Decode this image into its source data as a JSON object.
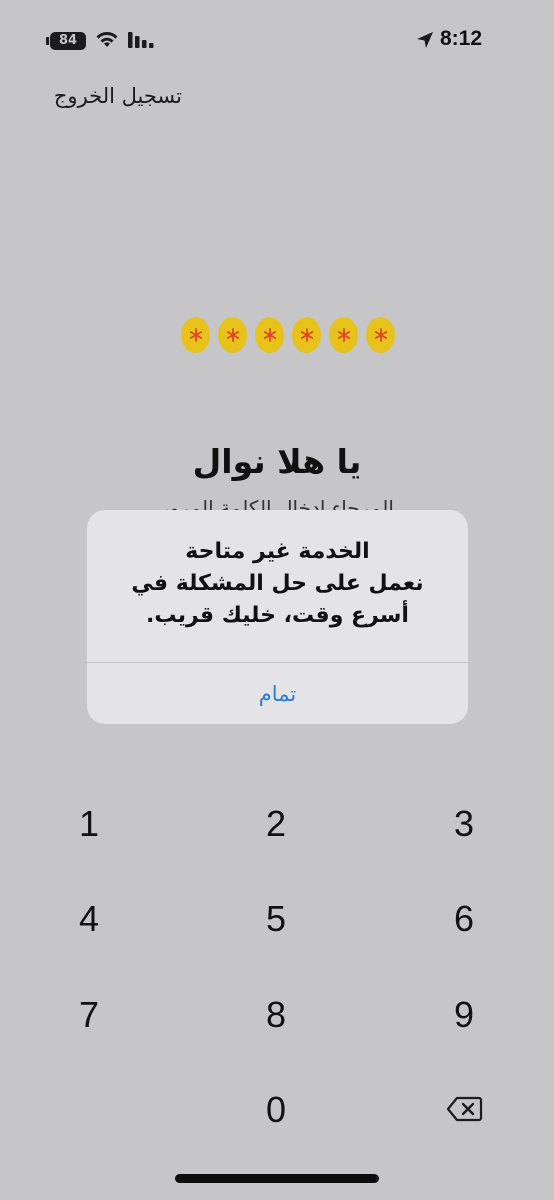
{
  "status_bar": {
    "battery": "84",
    "time": "8:12"
  },
  "header": {
    "logout_label": "تسجيل الخروج"
  },
  "pin": {
    "length": 6,
    "filled": 6,
    "dot_color": "#e7c21b",
    "star_color": "#e0442a"
  },
  "greeting": {
    "title": "يا هلا نوال",
    "subtitle": "المرجاء ادخال الكلمة المرور"
  },
  "alert": {
    "title": "الخدمة غير متاحة",
    "message": "نعمل على حل المشكلة في أسرع وقت، خليك قريب.",
    "button_label": "تمام",
    "button_color": "#2b7ed8"
  },
  "keypad": {
    "keys": [
      "1",
      "2",
      "3",
      "4",
      "5",
      "6",
      "7",
      "8",
      "9",
      "0"
    ],
    "delete_icon": "delete-backspace-icon"
  }
}
